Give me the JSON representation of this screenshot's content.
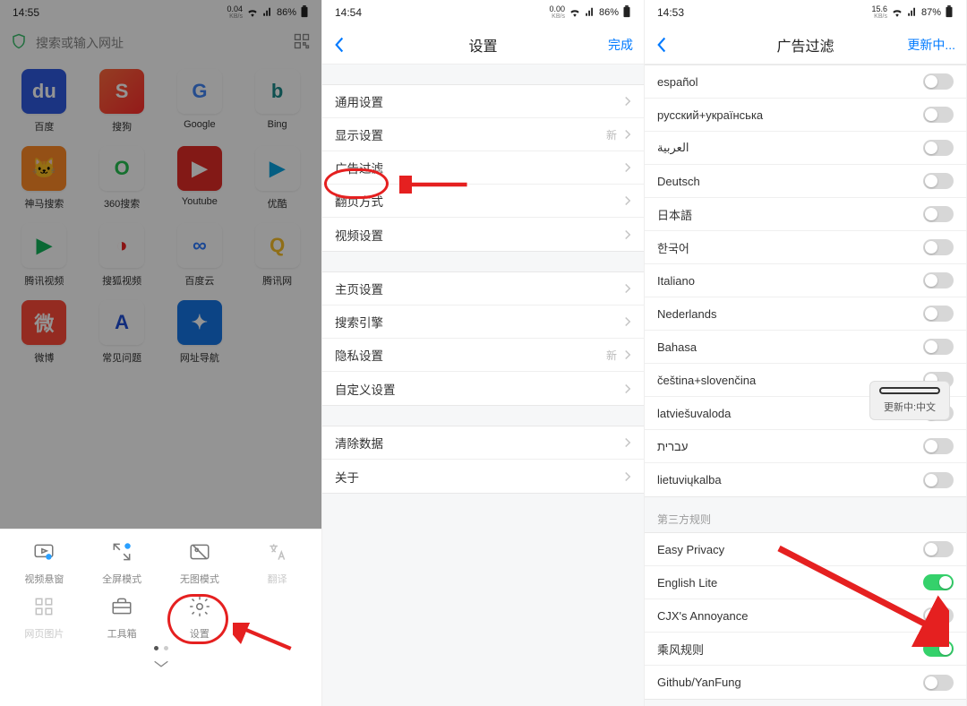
{
  "pane1": {
    "status": {
      "time": "14:55",
      "net": "0.04",
      "netunit": "KB/s",
      "batt": "86%"
    },
    "search_placeholder": "搜索或输入网址",
    "apps": [
      {
        "label": "百度",
        "icon_text": "du",
        "bg": "#2f5ae0",
        "fg": "#fff"
      },
      {
        "label": "搜狗",
        "icon_text": "S",
        "bg": "linear-gradient(135deg,#ff6a3d,#ff2d2d)",
        "fg": "#fff"
      },
      {
        "label": "Google",
        "icon_text": "G",
        "bg": "#fff",
        "fg": "#4285F4"
      },
      {
        "label": "Bing",
        "icon_text": "b",
        "bg": "#fff",
        "fg": "#1b8a8a"
      },
      {
        "label": "神马搜索",
        "icon_text": "🐱",
        "bg": "#ff8a26",
        "fg": "#fff"
      },
      {
        "label": "360搜索",
        "icon_text": "O",
        "bg": "#fff",
        "fg": "#26c152"
      },
      {
        "label": "Youtube",
        "icon_text": "▶",
        "bg": "#e22c27",
        "fg": "#fff"
      },
      {
        "label": "优酷",
        "icon_text": "▶",
        "bg": "#fff",
        "fg": "#0aa3e0"
      },
      {
        "label": "腾讯视频",
        "icon_text": "▶",
        "bg": "#fff",
        "fg": "#12b35a"
      },
      {
        "label": "搜狐视频",
        "icon_text": "◑",
        "bg": "#fff",
        "fg": "#e22"
      },
      {
        "label": "百度云",
        "icon_text": "∞",
        "bg": "#fff",
        "fg": "#2e7bff"
      },
      {
        "label": "腾讯网",
        "icon_text": "Q",
        "bg": "#fff",
        "fg": "#f7bd28"
      },
      {
        "label": "微博",
        "icon_text": "微",
        "bg": "#ff4b3a",
        "fg": "#fff"
      },
      {
        "label": "常见问题",
        "icon_text": "A",
        "bg": "#fff",
        "fg": "#1f4fd6"
      },
      {
        "label": "网址导航",
        "icon_text": "✦",
        "bg": "#1575e6",
        "fg": "#fff"
      }
    ],
    "menu": [
      {
        "label": "视频悬窗",
        "icon": "play"
      },
      {
        "label": "全屏模式",
        "icon": "expand"
      },
      {
        "label": "无图模式",
        "icon": "noimg"
      },
      {
        "label": "翻译",
        "icon": "translate",
        "faded": true
      },
      {
        "label": "网页图片",
        "icon": "grid",
        "faded": true
      },
      {
        "label": "工具箱",
        "icon": "toolbox"
      },
      {
        "label": "设置",
        "icon": "gear"
      }
    ]
  },
  "pane2": {
    "status": {
      "time": "14:54",
      "net": "0.00",
      "netunit": "KB/s",
      "batt": "86%"
    },
    "title": "设置",
    "done": "完成",
    "groups": [
      [
        {
          "label": "通用设置"
        },
        {
          "label": "显示设置",
          "badge": "新"
        },
        {
          "label": "广告过滤",
          "highlight": true
        },
        {
          "label": "翻页方式"
        },
        {
          "label": "视频设置"
        }
      ],
      [
        {
          "label": "主页设置"
        },
        {
          "label": "搜索引擎"
        },
        {
          "label": "隐私设置",
          "badge": "新"
        },
        {
          "label": "自定义设置"
        }
      ],
      [
        {
          "label": "清除数据"
        },
        {
          "label": "关于"
        }
      ]
    ]
  },
  "pane3": {
    "status": {
      "time": "14:53",
      "net": "15.6",
      "netunit": "KB/s",
      "batt": "87%"
    },
    "title": "广告过滤",
    "action": "更新中...",
    "toast": "更新中:中文",
    "rows": [
      {
        "label": "español",
        "on": false
      },
      {
        "label": "русский+українська",
        "on": false
      },
      {
        "label": "العربية",
        "on": false
      },
      {
        "label": "Deutsch",
        "on": false
      },
      {
        "label": "日本語",
        "on": false
      },
      {
        "label": "한국어",
        "on": false
      },
      {
        "label": "Italiano",
        "on": false
      },
      {
        "label": "Nederlands",
        "on": false
      },
      {
        "label": "Bahasa",
        "on": false
      },
      {
        "label": "čeština+slovenčina",
        "on": false
      },
      {
        "label": "latviešuvaloda",
        "on": false
      },
      {
        "label": "עברית",
        "on": false
      },
      {
        "label": "lietuviųkalba",
        "on": false
      }
    ],
    "section2_label": "第三方规则",
    "rows2": [
      {
        "label": "Easy Privacy",
        "on": false
      },
      {
        "label": "English Lite",
        "on": true
      },
      {
        "label": "CJX's Annoyance",
        "on": false
      },
      {
        "label": "乘风规则",
        "on": true
      },
      {
        "label": "Github/YanFung",
        "on": false
      }
    ]
  }
}
